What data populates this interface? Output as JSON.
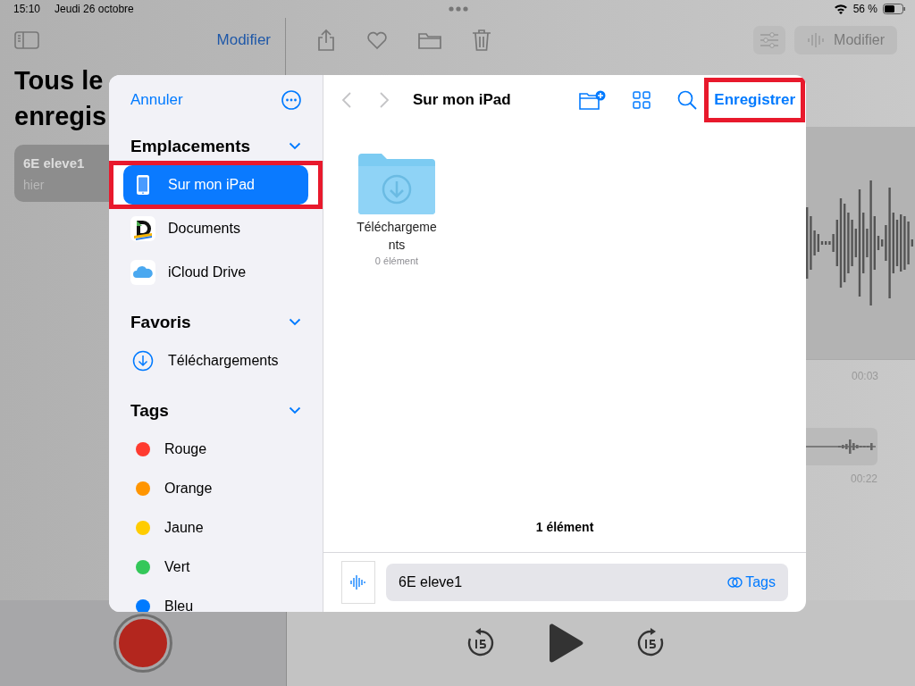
{
  "status_bar": {
    "time": "15:10",
    "date": "Jeudi 26 octobre",
    "battery": "56 %"
  },
  "list_pane": {
    "edit_button": "Modifier",
    "title_lines": [
      "Tous le",
      "enregis"
    ],
    "recordings": [
      {
        "name": "6E eleve1",
        "date": "hier",
        "selected": true
      }
    ]
  },
  "detail_pane": {
    "edit_button": "Modifier",
    "time_mark": "00:03",
    "duration": "00:22"
  },
  "dialog": {
    "cancel": "Annuler",
    "sections": [
      {
        "title": "Emplacements",
        "expanded": true,
        "kind": "locations",
        "items": [
          {
            "label": "Sur mon iPad",
            "selected": true,
            "highlighted": true
          },
          {
            "label": "Documents",
            "selected": false,
            "highlighted": false
          },
          {
            "label": "iCloud Drive",
            "selected": false,
            "highlighted": false
          }
        ]
      },
      {
        "title": "Favoris",
        "expanded": true,
        "kind": "favorites",
        "items": [
          {
            "label": "Téléchargements",
            "selected": false,
            "highlighted": false
          }
        ]
      },
      {
        "title": "Tags",
        "expanded": true,
        "kind": "tags",
        "items": [
          {
            "label": "Rouge",
            "color": "#ff3b30"
          },
          {
            "label": "Orange",
            "color": "#ff9500"
          },
          {
            "label": "Jaune",
            "color": "#ffcc00"
          },
          {
            "label": "Vert",
            "color": "#34c759"
          },
          {
            "label": "Bleu",
            "color": "#007aff"
          }
        ]
      }
    ],
    "location_title": "Sur mon iPad",
    "save_button": {
      "label": "Enregistrer",
      "highlighted": true
    },
    "folders": [
      {
        "name": "Téléchargements",
        "count": "0 élément"
      }
    ],
    "item_count": "1 élément",
    "file_name": "6E eleve1",
    "tags_button": "Tags"
  }
}
